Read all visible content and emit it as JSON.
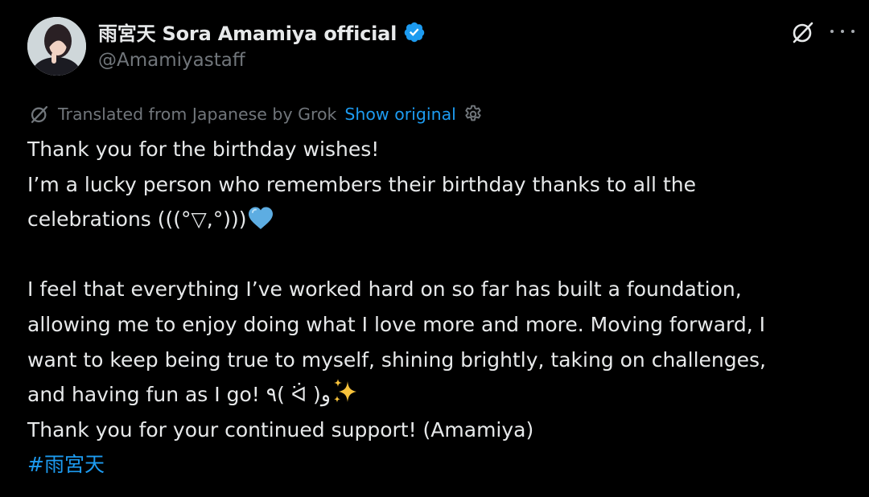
{
  "author": {
    "display_name": "雨宮天 Sora Amamiya official",
    "handle": "@Amamiyastaff",
    "verified": true
  },
  "translation": {
    "label": "Translated from Japanese by Grok",
    "show_original": "Show original"
  },
  "body": {
    "line1": "Thank you for the birthday wishes!",
    "line2": "I’m a lucky person who remembers their birthday thanks to all the",
    "line3": "celebrations (((°▽,°)))",
    "line4": "I feel that everything I’ve worked hard on so far has built a foundation,",
    "line5": "allowing me to enjoy doing what I love more and more. Moving forward, I",
    "line6": "want to keep being true to myself, shining brightly, taking on challenges,",
    "line7": "and having fun as I go! ٩( ᐛ )و",
    "line8": "Thank you for your continued support! (Amamiya)",
    "hashtag": "#雨宮天"
  },
  "icons": {
    "heart": "blue-heart-emoji",
    "sparkles": "sparkles-emoji",
    "verified": "verified-badge-icon",
    "grok": "grok-icon",
    "more": "more-icon",
    "settings": "gear-icon"
  },
  "colors": {
    "background": "#000000",
    "text": "#e7e9ea",
    "secondary_text": "#71767b",
    "accent": "#1d9bf0",
    "heart": "#5dade2",
    "sparkle": "#f7c23b"
  }
}
